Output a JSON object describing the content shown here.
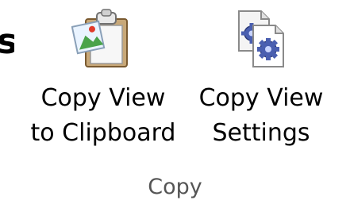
{
  "cutoff_text": "s",
  "ribbon": {
    "group_label": "Copy",
    "buttons": [
      {
        "line1": "Copy View",
        "line2": "to Clipboard",
        "icon": "clipboard-image-icon"
      },
      {
        "line1": "Copy View",
        "line2": "Settings",
        "icon": "copy-settings-gear-icon"
      }
    ]
  },
  "colors": {
    "clipboard_board": "#c8a878",
    "gear": "#4a5fb0",
    "group_label": "#555555"
  }
}
